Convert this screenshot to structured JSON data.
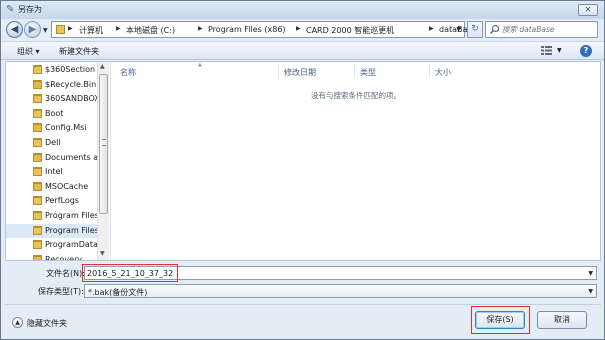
{
  "window": {
    "title": "另存为",
    "close_label": "✕"
  },
  "address": {
    "crumbs": [
      "计算机",
      "本地磁盘 (C:)",
      "Program Files (x86)",
      "CARD 2000 智能巡更机",
      "dataBase"
    ]
  },
  "search": {
    "placeholder": "搜索 dataBase"
  },
  "toolbar": {
    "organize_label": "组织 ▾",
    "new_folder_label": "新建文件夹",
    "help_label": "?"
  },
  "nav_tree": {
    "items": [
      {
        "label": "$360Section",
        "locked": false
      },
      {
        "label": "$Recycle.Bin",
        "locked": true
      },
      {
        "label": "360SANDBOX",
        "locked": false
      },
      {
        "label": "Boot",
        "locked": false
      },
      {
        "label": "Config.Msi",
        "locked": true
      },
      {
        "label": "Dell",
        "locked": false
      },
      {
        "label": "Documents ar",
        "locked": true
      },
      {
        "label": "Intel",
        "locked": false
      },
      {
        "label": "MSOCache",
        "locked": true
      },
      {
        "label": "PerfLogs",
        "locked": false
      },
      {
        "label": "Program Files",
        "locked": false
      },
      {
        "label": "Program Files",
        "locked": false,
        "selected": true
      },
      {
        "label": "ProgramData",
        "locked": false
      },
      {
        "label": "Recovery",
        "locked": true
      }
    ]
  },
  "file_list": {
    "columns": [
      "名称",
      "修改日期",
      "类型",
      "大小"
    ],
    "empty_message": "没有与搜索条件匹配的项。"
  },
  "form": {
    "filename_label": "文件名(N):",
    "filename_value": "2016_5_21_10_37_32",
    "type_label": "保存类型(T):",
    "type_value": "*.bak(备份文件)"
  },
  "footer": {
    "hide_folders_label": "隐藏文件夹",
    "save_label": "保存(S)",
    "cancel_label": "取消"
  },
  "colors": {
    "highlight": "#e03030",
    "selection": "#dbe8f8"
  }
}
